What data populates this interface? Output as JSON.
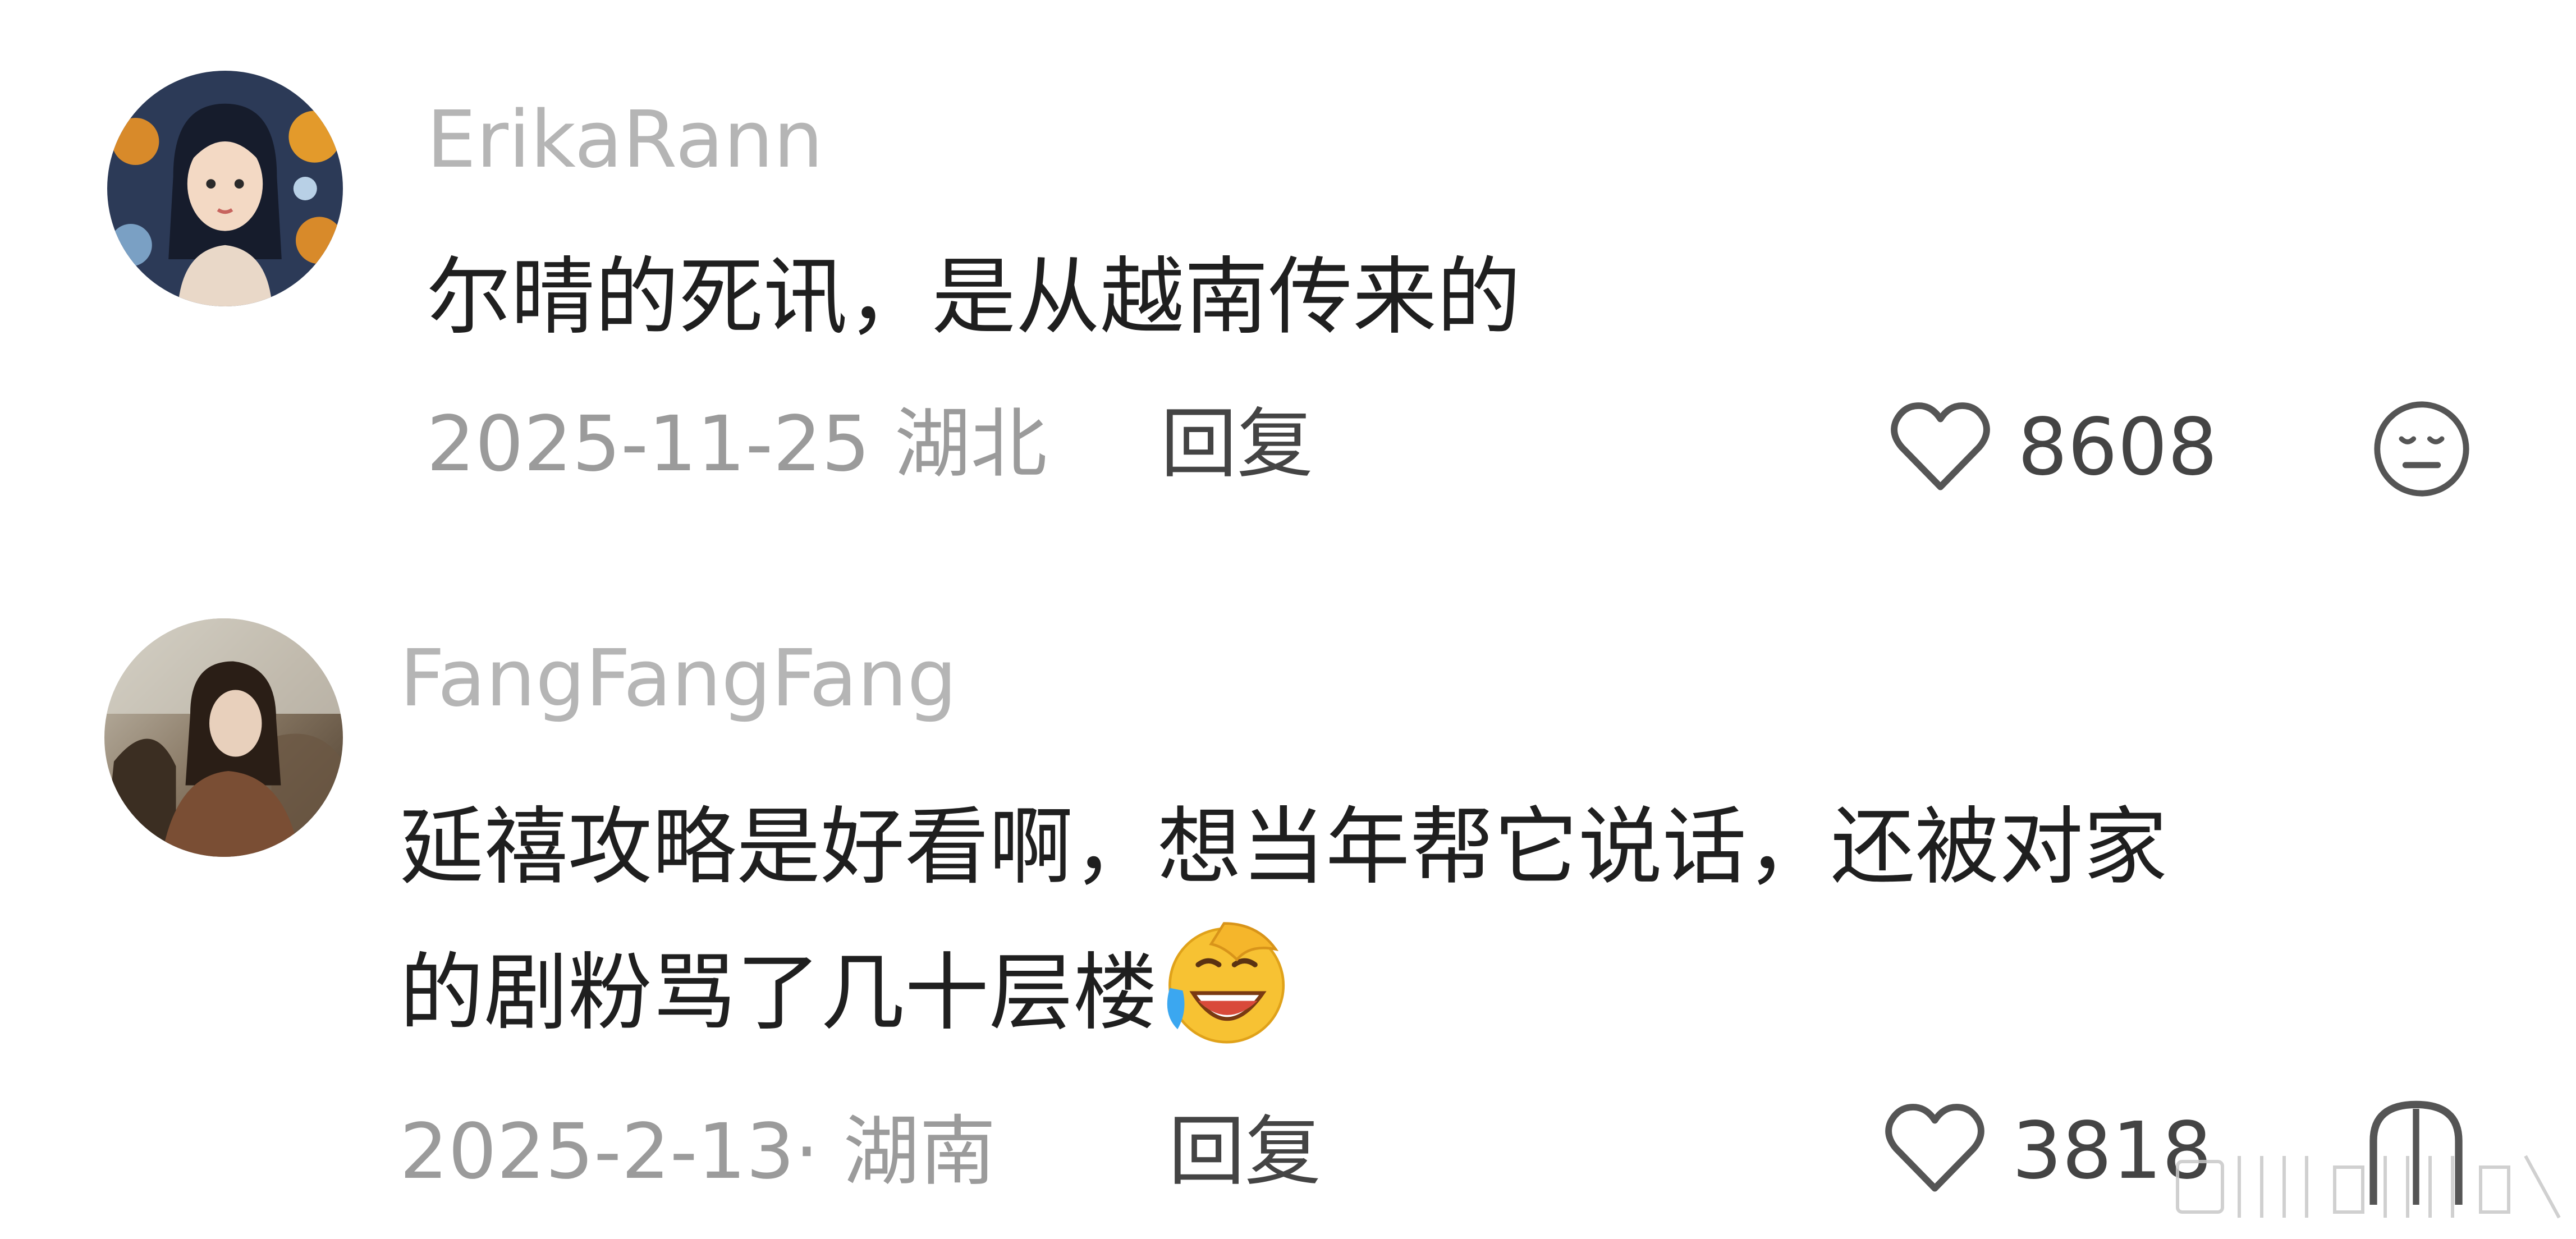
{
  "comments": [
    {
      "username": "ErikaRann",
      "text_lines": [
        "尔晴的死讯，是从越南传来的"
      ],
      "date": "2025-11-25",
      "location": "湖北",
      "reply_label": "回复",
      "like_count": "8608",
      "avatar_icon": "illustrated-woman-avatar"
    },
    {
      "username": "FangFangFang",
      "text_lines": [
        "延禧攻略是好看啊，想当年帮它说话，还被对家",
        "的剧粉骂了几十层楼"
      ],
      "emoji": "laughing-crying-emoji",
      "date": "2025-2-13·",
      "location": "湖南",
      "reply_label": "回复",
      "like_count": "3818",
      "avatar_icon": "photo-avatar"
    }
  ],
  "colors": {
    "username": "#b5b5b5",
    "text": "#1f1f1f",
    "meta": "#9b9b9b",
    "action": "#444444"
  }
}
